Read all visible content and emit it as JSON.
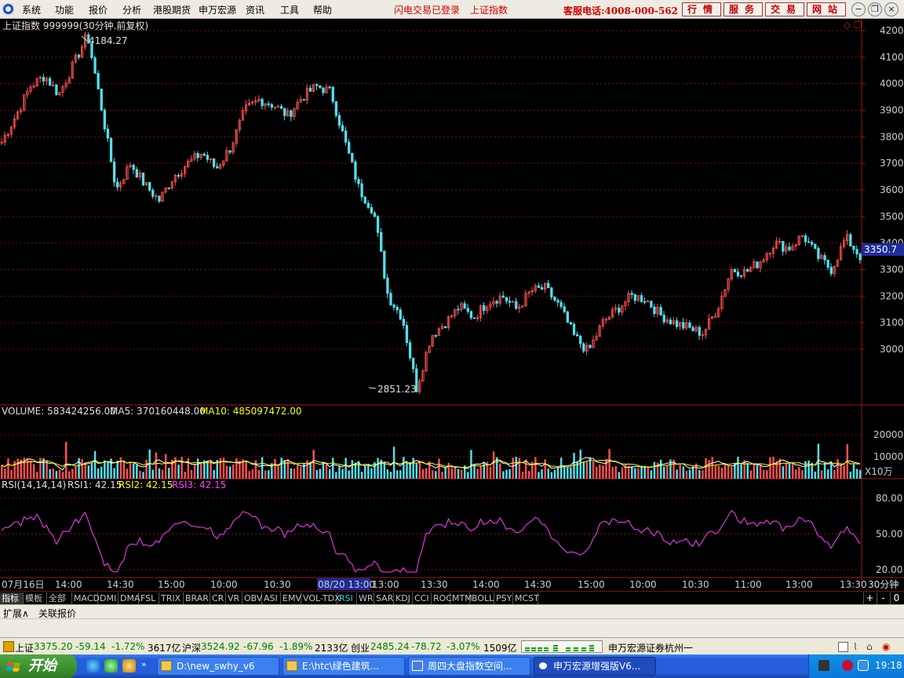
{
  "menu": {
    "items": [
      "系统",
      "功能",
      "报价",
      "分析",
      "港股期货",
      "申万宏源",
      "资讯",
      "工具",
      "帮助"
    ],
    "status1": "闪电交易已登录",
    "status2": "上证指数",
    "hotline": "客服电话:4008-000-562",
    "buttons": [
      "行情",
      "服务",
      "交易",
      "网站"
    ]
  },
  "chart": {
    "title": "上证指数 999999(30分钟.前复权)",
    "high_label": "4184.27",
    "low_label": "2851.23",
    "current_price": "3350.7",
    "y_ticks": [
      "4200",
      "4100",
      "4000",
      "3900",
      "3800",
      "3700",
      "3600",
      "3500",
      "3400",
      "3300",
      "3200",
      "3100",
      "3000"
    ],
    "volume_label": "VOLUME: 583424256.00",
    "ma5_label": "MA5: 370160448.00",
    "ma10_label": "MA10: 485097472.00",
    "vol_ticks": [
      "20000",
      "10000"
    ],
    "vol_unit": "X10万",
    "rsi_label": "RSI(14,14,14)",
    "rsi1_label": "RSI1: 42.15",
    "rsi2_label": "RSI2: 42.15",
    "rsi3_label": "RSI3: 42.15",
    "rsi_ticks": [
      "80.00",
      "50.00",
      "20.00"
    ],
    "x_labels": [
      "07月16日",
      "14:00",
      "14:30",
      "15:00",
      "10:00",
      "10:30",
      "08/20 13:00",
      "13:00",
      "13:30",
      "14:00",
      "14:30",
      "15:00",
      "10:00",
      "10:30",
      "11:00",
      "13:00",
      "13:30"
    ],
    "x_unit": "30分钟",
    "colors": {
      "up": "#ff5050",
      "down": "#50e0f0",
      "ma5": "#ffffff",
      "ma10": "#ffff00",
      "rsi": "#ff40ff"
    }
  },
  "chart_data": {
    "type": "candlestick",
    "instrument": "上证指数 999999",
    "interval": "30分钟",
    "price_axis": [
      3000,
      4200
    ],
    "high": 4184.27,
    "low": 2851.23,
    "last": 3350.7,
    "close_path_approx": [
      3780,
      3880,
      3990,
      4030,
      3960,
      4070,
      4184,
      3900,
      3600,
      3700,
      3620,
      3560,
      3650,
      3700,
      3740,
      3680,
      3760,
      3900,
      3940,
      3920,
      3880,
      3950,
      3990,
      3970,
      3780,
      3600,
      3520,
      3200,
      3120,
      2851,
      3050,
      3100,
      3160,
      3120,
      3180,
      3200,
      3150,
      3220,
      3230,
      3160,
      3050,
      2990,
      3100,
      3150,
      3200,
      3190,
      3130,
      3100,
      3080,
      3060,
      3150,
      3300,
      3290,
      3330,
      3400,
      3380,
      3430,
      3350,
      3300,
      3420,
      3350
    ],
    "rsi_axis": [
      20,
      80
    ],
    "rsi_last": 42.15
  },
  "tabs": [
    "指标",
    "模板",
    "全部",
    "MACD",
    "DMI",
    "DMA",
    "FSL",
    "TRIX",
    "BRAR",
    "CR",
    "VR",
    "OBV",
    "ASI",
    "EMV",
    "VOL-TDX",
    "RSI",
    "WR",
    "SAR",
    "KDJ",
    "CCI",
    "ROC",
    "MTM",
    "BOLL",
    "PSY",
    "MCST"
  ],
  "tab_ctrls": [
    "+",
    "-",
    "0"
  ],
  "bottom": {
    "expand": "扩展∧",
    "related": "关联报价"
  },
  "status": {
    "sh_name": "上证",
    "sh_price": "3375.20",
    "sh_chg": "-59.14",
    "sh_pct": "-1.72%",
    "sh_amt": "3617亿",
    "hs_name": "沪深",
    "hs_price": "3524.92",
    "hs_chg": "-67.96",
    "hs_pct": "-1.89%",
    "hs_amt": "2133亿",
    "cy_name": "创业",
    "cy_price": "2485.24",
    "cy_chg": "-78.72",
    "cy_pct": "-3.07%",
    "cy_amt": "1509亿",
    "broker": "申万宏源证券杭州一"
  },
  "taskbar": {
    "start": "开始",
    "tasks": [
      "D:\\new_swhy_v6",
      "E:\\htc\\绿色建筑...",
      "周四大盘指数空间...",
      "申万宏源增强版V6..."
    ],
    "clock": "19:18"
  }
}
